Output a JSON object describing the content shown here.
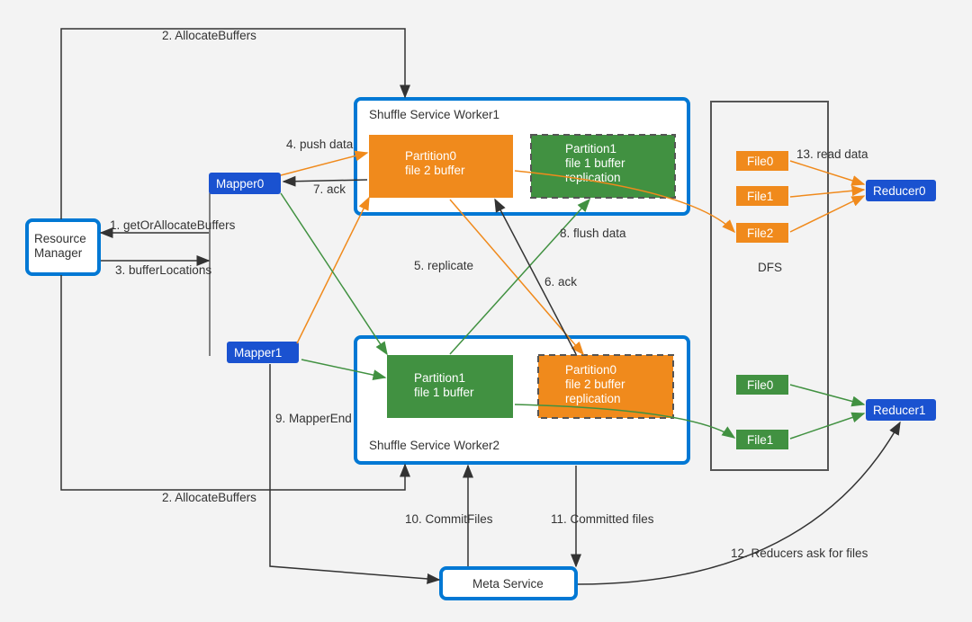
{
  "nodes": {
    "resource_manager": "Resource\nManager",
    "mapper0": "Mapper0",
    "mapper1": "Mapper1",
    "ssw1": {
      "title": "Shuffle Service Worker1",
      "p0": "Partition0\nfile 2 buffer",
      "p1": "Partition1\nfile 1 buffer\nreplication"
    },
    "ssw2": {
      "title": "Shuffle Service Worker2",
      "p1": "Partition1\nfile 1 buffer",
      "p0": "Partition0\nfile 2 buffer\nreplication"
    },
    "dfs": {
      "title": "DFS",
      "topFiles": [
        "File0",
        "File1",
        "File2"
      ],
      "botFiles": [
        "File0",
        "File1"
      ]
    },
    "reducer0": "Reducer0",
    "reducer1": "Reducer1",
    "meta": "Meta Service"
  },
  "edges": {
    "e1": "1. getOrAllocateBuffers",
    "e2a": "2. AllocateBuffers",
    "e2b": "2. AllocateBuffers",
    "e3": "3. bufferLocations",
    "e4": "4. push data",
    "e5": "5. replicate",
    "e6": "6. ack",
    "e7": "7. ack",
    "e8": "8. flush data",
    "e9": "9. MapperEnd",
    "e10": "10. CommitFiles",
    "e11": "11. Committed files",
    "e12": "12. Reducers ask for files",
    "e13": "13. read data"
  }
}
